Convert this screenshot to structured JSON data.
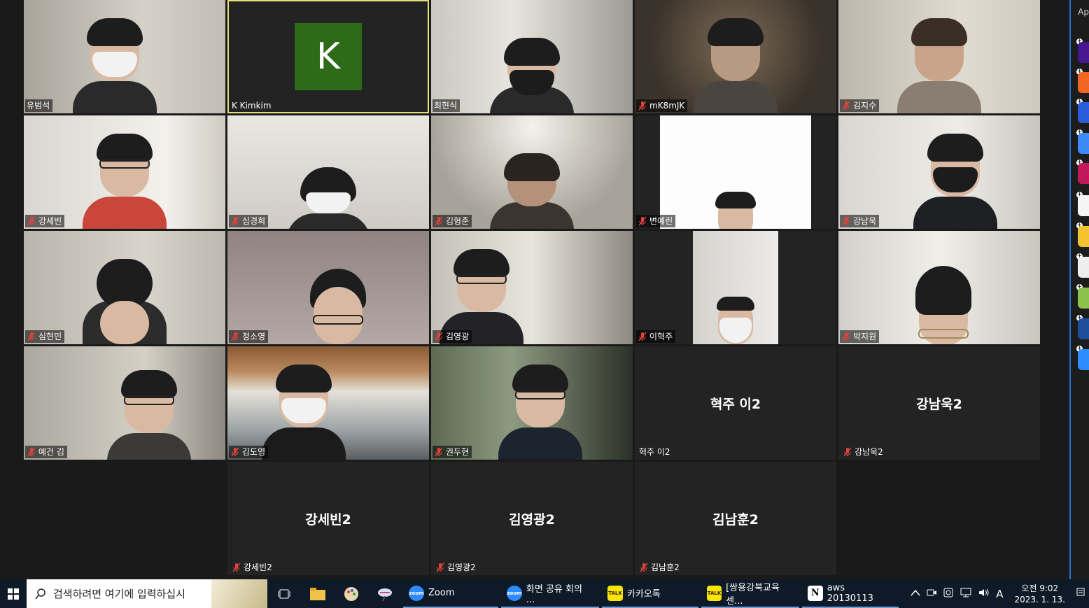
{
  "participants": [
    {
      "name": "유범석",
      "muted": false
    },
    {
      "name": "K Kimkim",
      "muted": false,
      "avatar_letter": "K"
    },
    {
      "name": "최현식",
      "muted": false
    },
    {
      "name": "mK8mJK",
      "muted": true
    },
    {
      "name": "김지수",
      "muted": true
    },
    {
      "name": "강세빈",
      "muted": true
    },
    {
      "name": "심경희",
      "muted": true
    },
    {
      "name": "김형준",
      "muted": true
    },
    {
      "name": "변예린",
      "muted": true
    },
    {
      "name": "강남욱",
      "muted": true
    },
    {
      "name": "심현민",
      "muted": true
    },
    {
      "name": "정소영",
      "muted": true
    },
    {
      "name": "김영광",
      "muted": true
    },
    {
      "name": "이혁주",
      "muted": true
    },
    {
      "name": "박지원",
      "muted": true
    },
    {
      "name": "예건 김",
      "muted": true
    },
    {
      "name": "김도영",
      "muted": true
    },
    {
      "name": "권두현",
      "muted": true
    },
    {
      "name": "혁주 이2",
      "muted": false,
      "video_off": true,
      "display": "혁주 이2"
    },
    {
      "name": "강남욱2",
      "muted": true,
      "video_off": true,
      "display": "강남욱2"
    },
    {
      "name": "강세빈2",
      "muted": true,
      "video_off": true,
      "display": "강세빈2"
    },
    {
      "name": "김영광2",
      "muted": true,
      "video_off": true,
      "display": "김영광2"
    },
    {
      "name": "김남훈2",
      "muted": true,
      "video_off": true,
      "display": "김남훈2"
    }
  ],
  "side_panel": {
    "label": "Ap"
  },
  "taskbar": {
    "search_placeholder": "검색하려면 여기에 입력하십시",
    "apps": [
      {
        "label": "Zoom",
        "badge": "zoom",
        "color": "#2d8cff"
      },
      {
        "label": "화면 공유 회의 ...",
        "badge": "zoom",
        "color": "#2d8cff"
      },
      {
        "label": "카카오톡",
        "badge": "TALK",
        "color": "#f7e600"
      },
      {
        "label": "[쌍용강북교육센...",
        "badge": "TALK",
        "color": "#f7e600"
      },
      {
        "label": "aws 20130113",
        "badge": "N",
        "color": "#ffffff"
      }
    ],
    "tray_ime": "A",
    "clock_time": "오전 9:02",
    "clock_date": "2023. 1. 13."
  },
  "colors": {
    "accent": "#2b6fd6",
    "active_speaker": "#e6e07a",
    "avatar": "#2e6b19",
    "mic_muted": "#e0433c"
  }
}
